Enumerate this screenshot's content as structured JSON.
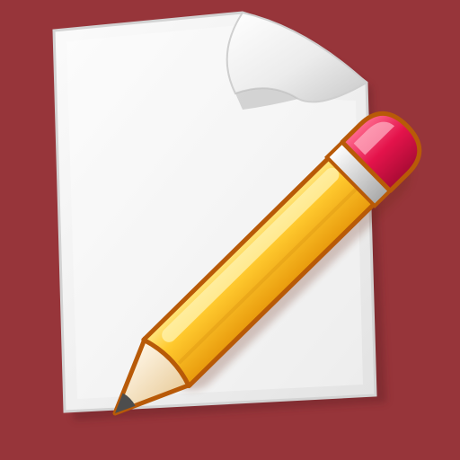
{
  "icon": {
    "name": "text-editor-icon",
    "depicts": [
      "document-page",
      "pencil"
    ]
  },
  "colors": {
    "background": "#97353a",
    "page_fill": "#f2f2f2",
    "page_edge": "#d7d7d7",
    "pencil_body": "#f6b91b",
    "pencil_highlight": "#ffe27a",
    "pencil_outline": "#b85a08",
    "eraser": "#e0134a",
    "ferrule": "#d9d9d9",
    "wood": "#f3dcb5",
    "lead": "#555555"
  }
}
